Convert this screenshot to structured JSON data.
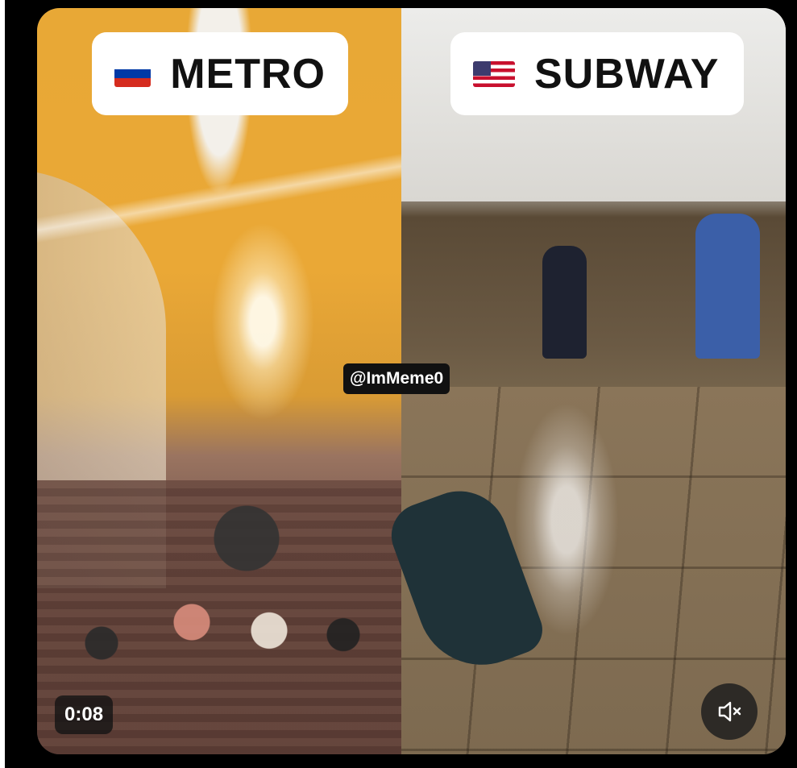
{
  "video": {
    "left_label": {
      "flag": "russia-flag-icon",
      "text": "METRO"
    },
    "right_label": {
      "flag": "usa-flag-icon",
      "text": "SUBWAY"
    },
    "watermark": "@ImMeme0",
    "timestamp": "0:08",
    "mute_icon": "speaker-muted-icon"
  },
  "colors": {
    "metro_vault": "#eaa836",
    "label_bg": "#ffffff",
    "overlay_bg": "#111111"
  }
}
